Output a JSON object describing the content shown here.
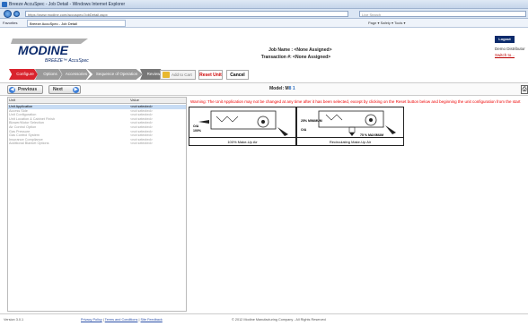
{
  "browser": {
    "title": "Breeze AccuSpec - Job Detail - Windows Internet Explorer",
    "url": "https://www.modine.com/accuspec/JobDetail.aspx",
    "search_placeholder": "Live Search",
    "favorites_label": "Favorites",
    "tab_label": "Breeze AccuSpec - Job Detail",
    "tools": "Page ▾  Safety ▾  Tools ▾"
  },
  "header": {
    "logo_brand": "MODINE",
    "logo_product": "BREEZE™ AccuSpec",
    "job_name_label": "Job Name",
    "job_name_value": ": <None Assigned>",
    "transaction_label": "Transaction # ",
    "transaction_value": ": <None Assigned>",
    "logout": "Logout",
    "distributor": "Demo Distributor",
    "switch_to": "Switch to..."
  },
  "steps": [
    {
      "label": "Configure",
      "color": "#d9232d"
    },
    {
      "label": "Options",
      "color": "#9a9a9a"
    },
    {
      "label": "Accessories",
      "color": "#9a9a9a"
    },
    {
      "label": "Sequence of Operation",
      "color": "#9a9a9a"
    },
    {
      "label": "Review",
      "color": "#777777"
    }
  ],
  "actions": {
    "add_to_cart": "Add to Cart",
    "reset_unit": "Reset Unit",
    "cancel": "Cancel"
  },
  "pager": {
    "previous": "Previous",
    "next": "Next",
    "model_label": "Model: M",
    "model_value": "8 1"
  },
  "grid": {
    "col_unit": "Unit",
    "col_value": "Value",
    "rows": [
      {
        "unit": "Unit Application",
        "value": "<not selected>",
        "selected": true
      },
      {
        "unit": "Access Side",
        "value": "<not selected>",
        "selected": false
      },
      {
        "unit": "Unit Configuration",
        "value": "<not selected>",
        "selected": false
      },
      {
        "unit": "Unit Location & Cabinet Finish",
        "value": "<not selected>",
        "selected": false
      },
      {
        "unit": "Blower/Motor Selection",
        "value": "<not selected>",
        "selected": false
      },
      {
        "unit": "Air Control Option",
        "value": "<not selected>",
        "selected": false
      },
      {
        "unit": "Gas Pressure",
        "value": "<not selected>",
        "selected": false
      },
      {
        "unit": "Gas Control System",
        "value": "<not selected>",
        "selected": false
      },
      {
        "unit": "Insurance Compliance",
        "value": "<not selected>",
        "selected": false
      },
      {
        "unit": "Additional Blanket Options",
        "value": "<not selected>",
        "selected": false
      }
    ]
  },
  "warning": "Warning: The Unit Application may not be changed at any time after it has been selected, except by clicking on the Reset button below and beginning the unit configuration from the start",
  "options": [
    {
      "caption": "100% Make-Up Air",
      "oa_label": "O/A",
      "oa_pct": "100%"
    },
    {
      "caption": "Recirculating Make-Up Air",
      "oa_label": "O/A",
      "min_label": "25% MINIMUM",
      "max_label": "75 % MAXIMUM"
    }
  ],
  "footer": {
    "version": "Version 3.0.1",
    "privacy": "Privacy Policy",
    "terms": "Terms and Conditions",
    "feedback": "Site Feedback",
    "copyright": "© 2012 Modine Manufacturing Company - All Rights Reserved"
  },
  "colors": {
    "accent_red": "#d9232d",
    "navy": "#0b2a6b",
    "warning_red": "#e00000"
  }
}
